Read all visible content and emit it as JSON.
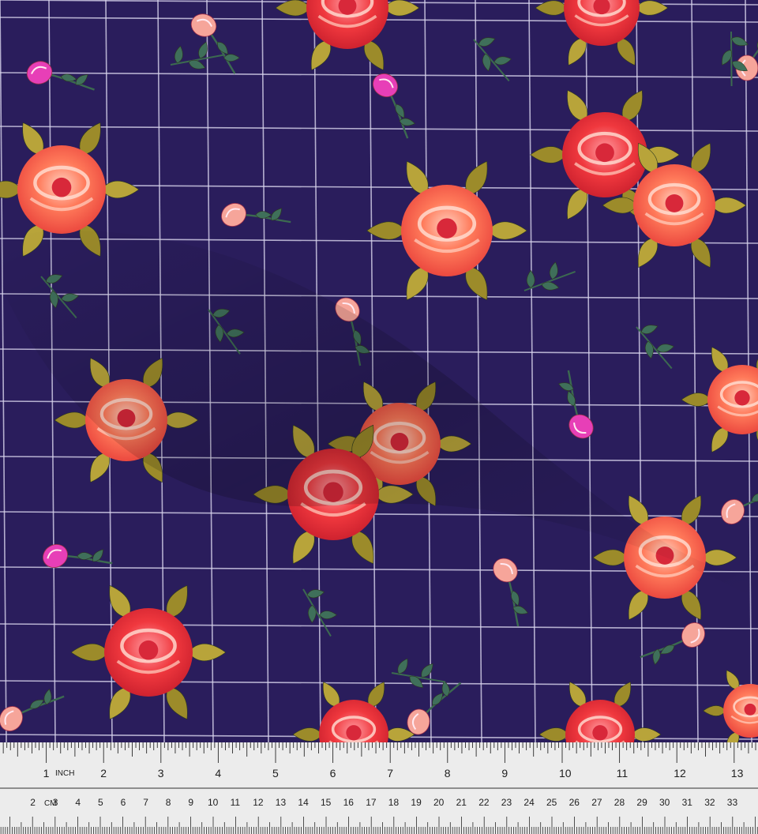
{
  "fabric": {
    "background_color": "#2a1d5c",
    "grid_line_color": "#d8d4ec",
    "rose_colors": [
      "#ff5a3c",
      "#f47a5a",
      "#e8324a",
      "#ff8a70"
    ],
    "bud_colors": [
      "#f6a59a",
      "#e73fb7"
    ],
    "leaf_colors": [
      "#9c8b2a",
      "#3f6f5a"
    ],
    "motif": "roses on windowpane check"
  },
  "ruler": {
    "background_color": "#ececec",
    "inch_unit_label": "INCH",
    "cm_unit_label": "CM",
    "inch_numbers": [
      "1",
      "2",
      "3",
      "4",
      "5",
      "6",
      "7",
      "8",
      "9",
      "10",
      "11",
      "12",
      "13"
    ],
    "cm_numbers": [
      "2",
      "3",
      "4",
      "5",
      "6",
      "7",
      "8",
      "9",
      "10",
      "11",
      "12",
      "13",
      "14",
      "15",
      "16",
      "17",
      "18",
      "19",
      "20",
      "21",
      "22",
      "23",
      "24",
      "25",
      "26",
      "27",
      "28",
      "29",
      "30",
      "31",
      "32",
      "33"
    ]
  }
}
